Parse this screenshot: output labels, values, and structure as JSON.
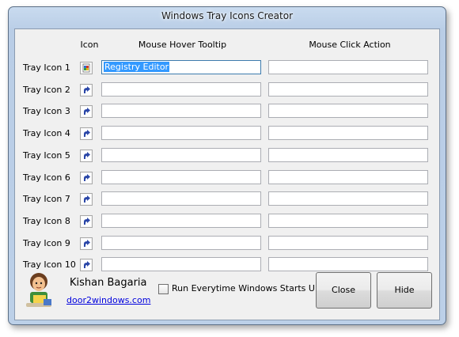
{
  "window": {
    "title": "Windows Tray Icons Creator"
  },
  "headers": {
    "icon": "Icon",
    "tooltip": "Mouse Hover Tooltip",
    "action": "Mouse Click Action"
  },
  "rows": [
    {
      "label": "Tray Icon 1",
      "icon": "registry-editor-icon",
      "tooltip": "Registry Editor",
      "action": ""
    },
    {
      "label": "Tray Icon 2",
      "icon": "shortcut-arrow-icon",
      "tooltip": "",
      "action": ""
    },
    {
      "label": "Tray Icon 3",
      "icon": "shortcut-arrow-icon",
      "tooltip": "",
      "action": ""
    },
    {
      "label": "Tray Icon 4",
      "icon": "shortcut-arrow-icon",
      "tooltip": "",
      "action": ""
    },
    {
      "label": "Tray Icon 5",
      "icon": "shortcut-arrow-icon",
      "tooltip": "",
      "action": ""
    },
    {
      "label": "Tray Icon 6",
      "icon": "shortcut-arrow-icon",
      "tooltip": "",
      "action": ""
    },
    {
      "label": "Tray Icon 7",
      "icon": "shortcut-arrow-icon",
      "tooltip": "",
      "action": ""
    },
    {
      "label": "Tray Icon 8",
      "icon": "shortcut-arrow-icon",
      "tooltip": "",
      "action": ""
    },
    {
      "label": "Tray Icon 9",
      "icon": "shortcut-arrow-icon",
      "tooltip": "",
      "action": ""
    },
    {
      "label": "Tray Icon 10",
      "icon": "shortcut-arrow-icon",
      "tooltip": "",
      "action": ""
    }
  ],
  "footer": {
    "author": "Kishan Bagaria",
    "link": "door2windows.com",
    "startup_label": "Run Everytime Windows Starts Up",
    "startup_checked": false,
    "close_label": "Close",
    "hide_label": "Hide"
  }
}
